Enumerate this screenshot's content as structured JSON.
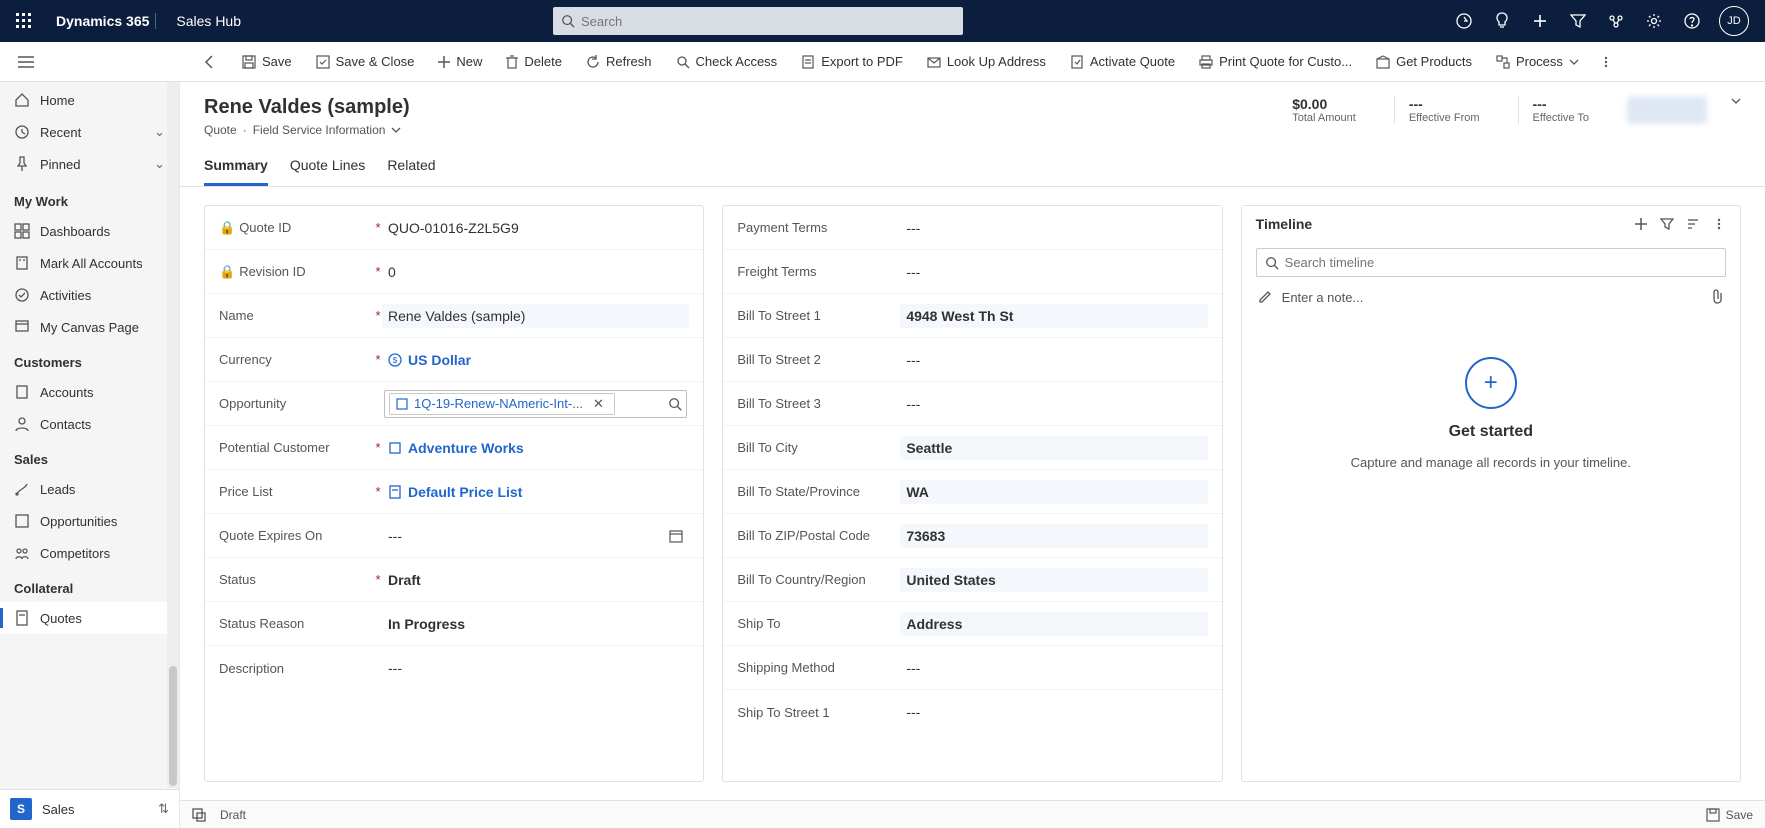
{
  "topbar": {
    "brand": "Dynamics 365",
    "app": "Sales Hub",
    "search_placeholder": "Search",
    "avatar_initials": "JD"
  },
  "cmdbar": {
    "save": "Save",
    "save_close": "Save & Close",
    "new": "New",
    "delete": "Delete",
    "refresh": "Refresh",
    "check_access": "Check Access",
    "export_pdf": "Export to PDF",
    "lookup_address": "Look Up Address",
    "activate_quote": "Activate Quote",
    "print_quote": "Print Quote for Custo...",
    "get_products": "Get Products",
    "process": "Process"
  },
  "nav": {
    "home": "Home",
    "recent": "Recent",
    "pinned": "Pinned",
    "my_work": "My Work",
    "dashboards": "Dashboards",
    "mark_all_accounts": "Mark All Accounts",
    "activities": "Activities",
    "my_canvas_page": "My Canvas Page",
    "customers": "Customers",
    "accounts": "Accounts",
    "contacts": "Contacts",
    "sales": "Sales",
    "leads": "Leads",
    "opportunities": "Opportunities",
    "competitors": "Competitors",
    "collateral": "Collateral",
    "quotes": "Quotes",
    "area_switch": "Sales",
    "area_letter": "S"
  },
  "header": {
    "title": "Rene Valdes (sample)",
    "sub_entity": "Quote",
    "sub_form": "Field Service Information",
    "metrics": {
      "total_amount_val": "$0.00",
      "total_amount_lbl": "Total Amount",
      "eff_from_val": "---",
      "eff_from_lbl": "Effective From",
      "eff_to_val": "---",
      "eff_to_lbl": "Effective To"
    }
  },
  "tabs": {
    "summary": "Summary",
    "quote_lines": "Quote Lines",
    "related": "Related"
  },
  "fields_left": {
    "quote_id_lbl": "Quote ID",
    "quote_id_val": "QUO-01016-Z2L5G9",
    "revision_id_lbl": "Revision ID",
    "revision_id_val": "0",
    "name_lbl": "Name",
    "name_val": "Rene Valdes (sample)",
    "currency_lbl": "Currency",
    "currency_val": "US Dollar",
    "opportunity_lbl": "Opportunity",
    "opportunity_val": "1Q-19-Renew-NAmeric-Int-...",
    "potential_customer_lbl": "Potential Customer",
    "potential_customer_val": "Adventure Works",
    "price_list_lbl": "Price List",
    "price_list_val": "Default Price List",
    "quote_expires_lbl": "Quote Expires On",
    "quote_expires_val": "---",
    "status_lbl": "Status",
    "status_val": "Draft",
    "status_reason_lbl": "Status Reason",
    "status_reason_val": "In Progress",
    "description_lbl": "Description",
    "description_val": "---"
  },
  "fields_right": {
    "payment_terms_lbl": "Payment Terms",
    "payment_terms_val": "---",
    "freight_terms_lbl": "Freight Terms",
    "freight_terms_val": "---",
    "bill_street1_lbl": "Bill To Street 1",
    "bill_street1_val": "4948 West Th St",
    "bill_street2_lbl": "Bill To Street 2",
    "bill_street2_val": "---",
    "bill_street3_lbl": "Bill To Street 3",
    "bill_street3_val": "---",
    "bill_city_lbl": "Bill To City",
    "bill_city_val": "Seattle",
    "bill_state_lbl": "Bill To State/Province",
    "bill_state_val": "WA",
    "bill_zip_lbl": "Bill To ZIP/Postal Code",
    "bill_zip_val": "73683",
    "bill_country_lbl": "Bill To Country/Region",
    "bill_country_val": "United States",
    "ship_to_lbl": "Ship To",
    "ship_to_val": "Address",
    "shipping_method_lbl": "Shipping Method",
    "shipping_method_val": "---",
    "ship_street1_lbl": "Ship To Street 1",
    "ship_street1_val": "---"
  },
  "timeline": {
    "title": "Timeline",
    "search_placeholder": "Search timeline",
    "note_placeholder": "Enter a note...",
    "get_started": "Get started",
    "get_started_sub": "Capture and manage all records in your timeline."
  },
  "footer": {
    "status": "Draft",
    "save": "Save"
  }
}
